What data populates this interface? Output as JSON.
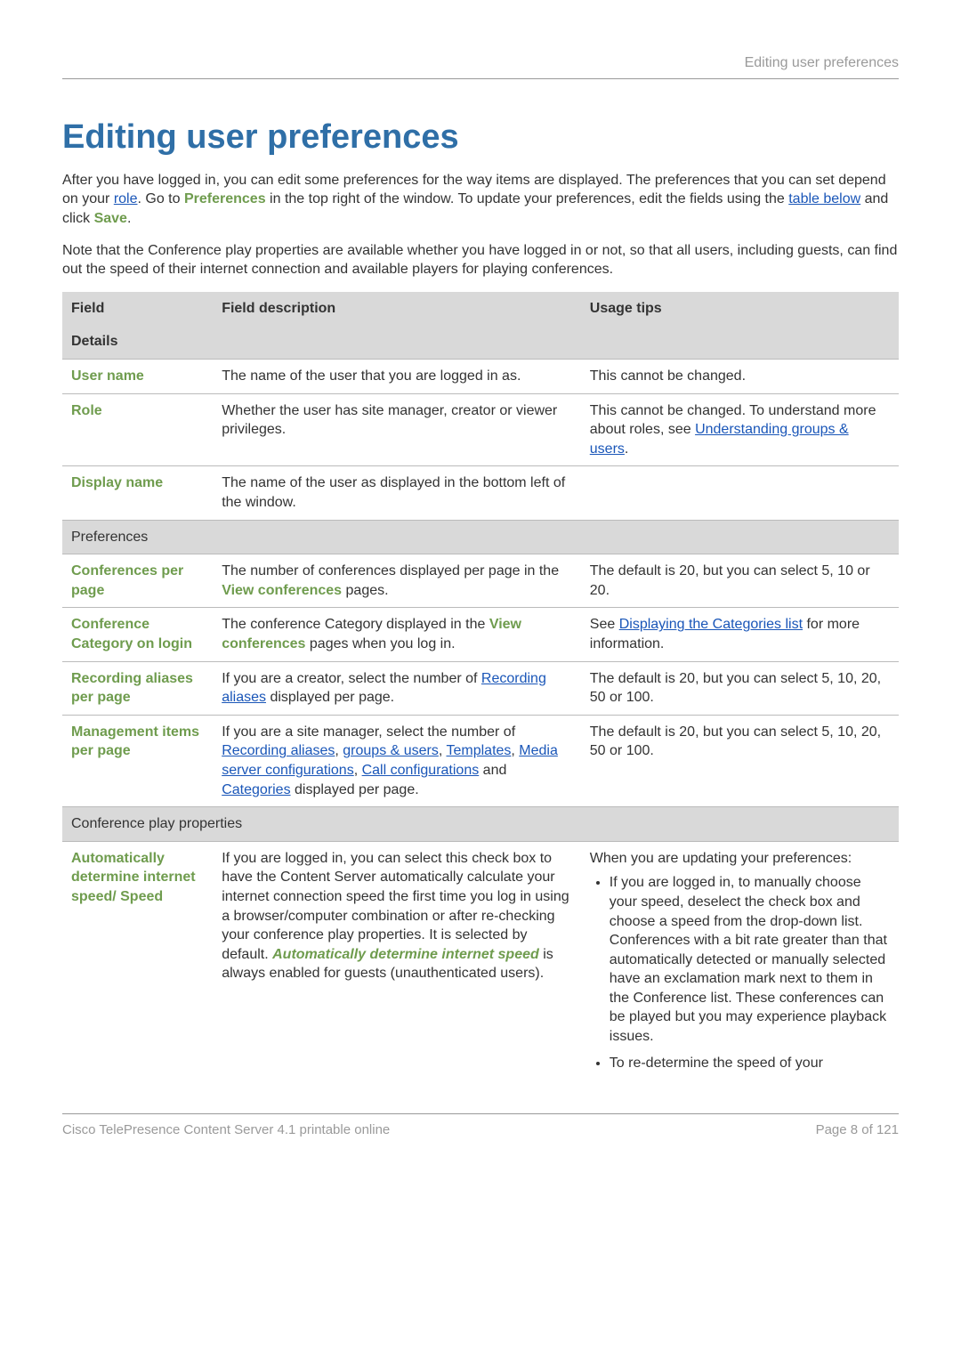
{
  "header": {
    "top_right": "Editing user preferences"
  },
  "title": "Editing user preferences",
  "intro": {
    "p1_a": "After you have logged in, you can edit some preferences for the way items are displayed. The preferences that you can set depend on your ",
    "role_link": "role",
    "p1_b": ". Go to ",
    "pref_word": "Preferences",
    "p1_c": " in the top right of the window. To update your preferences, edit the fields using the ",
    "table_link": "table below",
    "p1_d": " and click ",
    "save_word": "Save",
    "p1_e": ".",
    "p2": "Note that the Conference play properties are available whether you have logged in or not, so that all users, including guests, can find out the speed of their internet connection and available players for playing conferences."
  },
  "table": {
    "headers": {
      "field": "Field",
      "desc": "Field description",
      "tips": "Usage tips"
    },
    "section_details": "Details",
    "username": {
      "field": "User name",
      "desc": "The name of the user that you are logged in as.",
      "tips": "This cannot be changed."
    },
    "role": {
      "field": "Role",
      "desc": "Whether the user has site manager, creator or viewer privileges.",
      "tips_a": "This cannot be changed. To understand more about roles, see ",
      "tips_link": "Understanding groups & users",
      "tips_b": "."
    },
    "displayname": {
      "field": "Display name",
      "desc": "The name of the user as displayed in the bottom left of the window."
    },
    "section_prefs": "Preferences",
    "confper": {
      "field": "Conferences per page",
      "desc_a": "The number of conferences displayed per page in the ",
      "desc_b": "View conferences",
      "desc_c": " pages.",
      "tips": "The default is 20, but you can select 5, 10 or 20."
    },
    "confcat": {
      "field": "Conference Category on login",
      "desc_a": "The conference Category displayed in the ",
      "desc_b": "View conferences",
      "desc_c": " pages when you log in.",
      "tips_a": "See ",
      "tips_link": "Displaying the Categories list",
      "tips_b": " for more information."
    },
    "recalias": {
      "field": "Recording aliases per page",
      "desc_a": "If you are a creator, select the number of ",
      "desc_link": "Recording aliases",
      "desc_b": " displayed per page.",
      "tips": "The default is 20, but you can select 5, 10, 20, 50 or 100."
    },
    "mgmt": {
      "field": "Management items per page",
      "desc_a": "If you are a site manager, select the number of ",
      "l1": "Recording aliases",
      "sep1": ", ",
      "l2": "groups & users",
      "sep2": ", ",
      "l3": "Templates",
      "sep3": ", ",
      "l4": "Media server configurations",
      "sep4": ", ",
      "l5": "Call configurations",
      "sep5": " and ",
      "l6": "Categories",
      "desc_b": " displayed per page.",
      "tips": "The default is 20, but you can select 5, 10, 20, 50 or 100."
    },
    "section_play": "Conference play properties",
    "auto": {
      "field": "Automatically determine internet speed/ Speed",
      "desc_a": "If you are logged in, you can select this check box to have the Content Server automatically calculate your internet connection speed the first time you log in using a browser/computer combination or after re-checking your conference play properties. It is selected by default. ",
      "desc_em": "Automatically determine internet speed",
      "desc_b": " is always enabled for guests (unauthenticated users).",
      "tips_intro": "When you are updating your preferences:",
      "tips_b1": "If you are logged in, to manually choose your speed, deselect the check box and choose a speed from the drop-down list. Conferences with a bit rate greater than that automatically detected or manually selected have an exclamation mark next to them in the Conference list. These conferences can be played but you may experience playback issues.",
      "tips_b2": "To re-determine the speed of your"
    }
  },
  "footer": {
    "left": "Cisco TelePresence Content Server 4.1 printable online",
    "right": "Page 8 of 121"
  }
}
